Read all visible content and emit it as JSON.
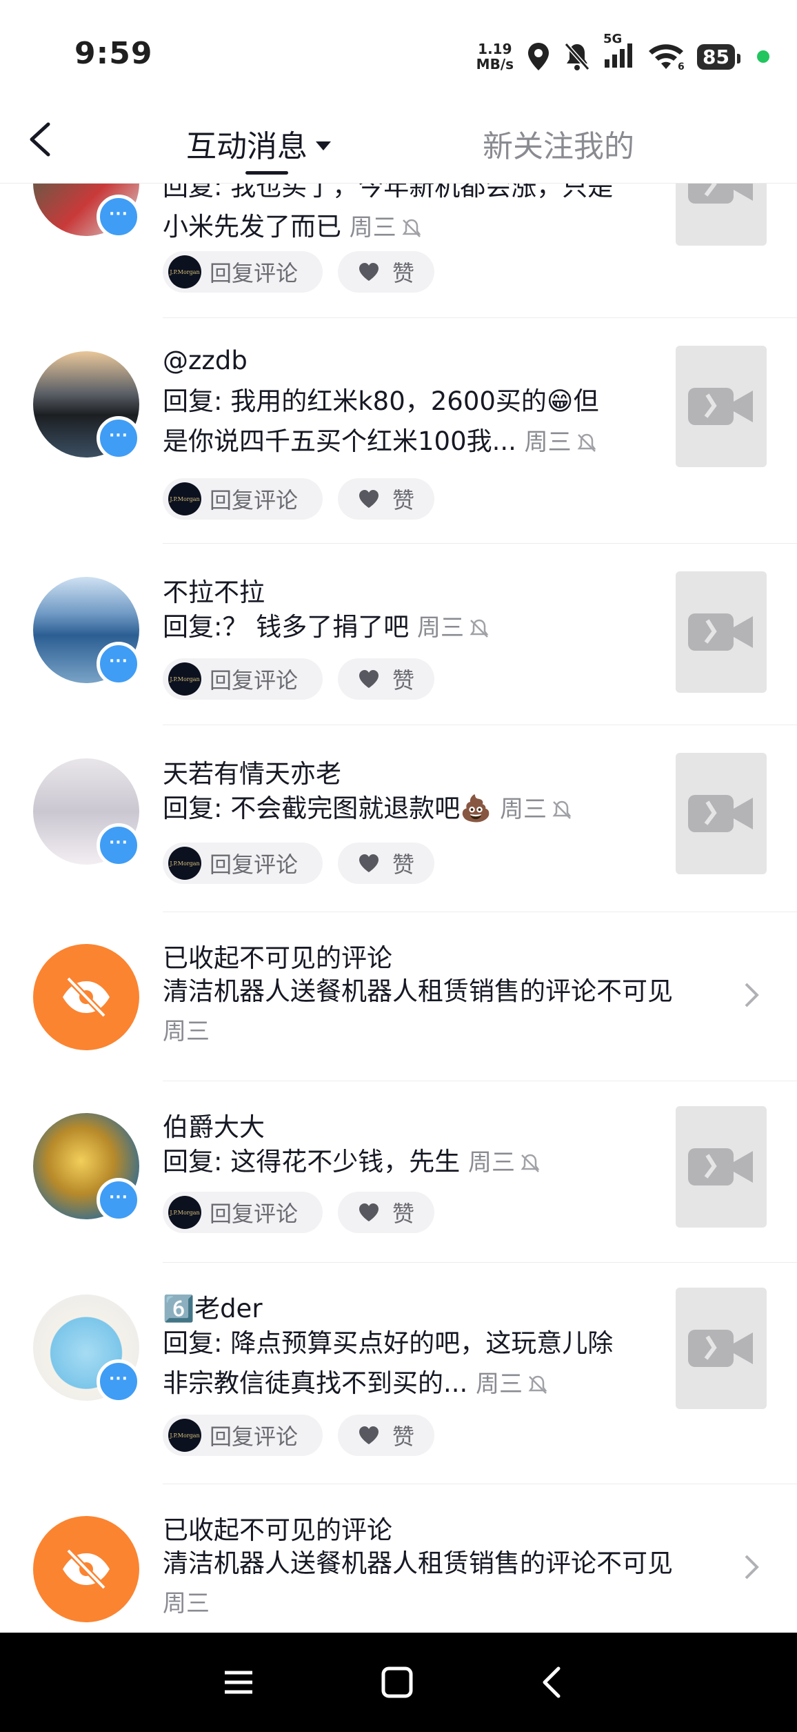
{
  "status_bar": {
    "time": "9:59",
    "net_speed_value": "1.19",
    "net_speed_unit": "MB/s",
    "network": "5G",
    "battery": "85",
    "icons": [
      "location-icon",
      "mute-bell-icon",
      "signal-icon",
      "wifi-icon",
      "battery-icon"
    ]
  },
  "header": {
    "active_tab": "互动消息",
    "other_tab": "新关注我的"
  },
  "reply_label": "回复评论",
  "like_label": "赞",
  "jpm_label": "J.P.Morgan",
  "items": [
    {
      "type": "comment",
      "name": "",
      "text": "回复: 我也买了，今年新机都会涨，只是小米先发了而已",
      "line1": "回复: 我也买了，今年新机都会涨，只是",
      "line2": "小米先发了而已",
      "time": "周三"
    },
    {
      "type": "comment",
      "name": "@zzdb",
      "line1": "回复: 我用的红米k80，2600买的😁但",
      "line2": "是你说四千五买个红米100我...",
      "time": "周三"
    },
    {
      "type": "comment",
      "name": "不拉不拉",
      "line1": "回复:？ 钱多了捐了吧",
      "time": "周三"
    },
    {
      "type": "comment",
      "name": "天若有情天亦老",
      "line1": "回复: 不会截完图就退款吧💩",
      "time": "周三"
    },
    {
      "type": "hidden",
      "title": "已收起不可见的评论",
      "desc": "清洁机器人送餐机器人租赁销售的评论不可见",
      "time": "周三"
    },
    {
      "type": "comment",
      "name": "伯爵大大",
      "line1": "回复: 这得花不少钱，先生",
      "time": "周三"
    },
    {
      "type": "comment",
      "name": "6️⃣老der",
      "line1": "回复: 降点预算买点好的吧，这玩意儿除",
      "line2": "非宗教信徒真找不到买的...",
      "time": "周三"
    },
    {
      "type": "hidden",
      "title": "已收起不可见的评论",
      "desc": "清洁机器人送餐机器人租赁销售的评论不可见",
      "time": "周三"
    }
  ],
  "colors": {
    "accent_blue": "#3f9df5",
    "hidden_orange": "#fb8431",
    "muted_text": "#8a8b91",
    "primary_text": "#161823"
  }
}
